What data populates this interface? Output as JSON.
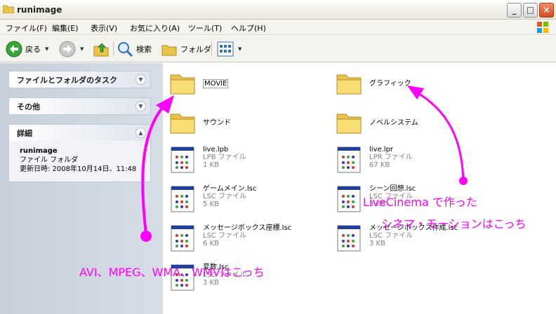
{
  "window": {
    "title": "runimage",
    "btn_min": "_",
    "btn_max": "□",
    "btn_close": "×"
  },
  "menu": [
    {
      "label": "ファイル(F)"
    },
    {
      "label": "編集(E)"
    },
    {
      "label": "表示(V)"
    },
    {
      "label": "お気に入り(A)"
    },
    {
      "label": "ツール(T)"
    },
    {
      "label": "ヘルプ(H)"
    }
  ],
  "toolbar": {
    "back": "戻る",
    "search": "検索",
    "folders": "フォルダ"
  },
  "sidebar": {
    "tasks_title": "ファイルとフォルダのタスク",
    "other_title": "その他",
    "details_title": "詳細",
    "details_name": "runimage",
    "details_type": "ファイル フォルダ",
    "details_date": "更新日時: 2008年10月14日、11:48"
  },
  "items": [
    {
      "name": "MOVIE",
      "kind": "folder"
    },
    {
      "name": "グラフィック",
      "kind": "folder"
    },
    {
      "name": "サウンド",
      "kind": "folder"
    },
    {
      "name": "ノベルシステム",
      "kind": "folder"
    },
    {
      "name": "live.lpb",
      "type": "LPB ファイル",
      "size": "1 KB",
      "kind": "file"
    },
    {
      "name": "live.lpr",
      "type": "LPR ファイル",
      "size": "67 KB",
      "kind": "file"
    },
    {
      "name": "ゲームメイン.lsc",
      "type": "LSC ファイル",
      "size": "5 KB",
      "kind": "file"
    },
    {
      "name": "シーン回想.lsc",
      "type": "LSC ファイル",
      "size": "3 KB",
      "kind": "file"
    },
    {
      "name": "メッセージボックス座標.lsc",
      "type": "LSC ファイル",
      "size": "6 KB",
      "kind": "file"
    },
    {
      "name": "メッセージボックス作成.lsc",
      "type": "LSC ファイル",
      "size": "3 KB",
      "kind": "file"
    },
    {
      "name": "変数.lsc",
      "type": "LSC ファイル",
      "size": "3 KB",
      "kind": "file"
    }
  ],
  "annotations": {
    "bottom": "AVI、MPEG、WMA、WMVはこっち",
    "right_line1": "LiveCinema で作った",
    "right_line2": "シネマ・モーションはこっち",
    "color": "#ff00ff"
  },
  "icons": {
    "window": "folder-icon",
    "back": "back-arrow-icon",
    "forward": "forward-arrow-icon",
    "up": "up-folder-icon",
    "search": "search-icon",
    "folders": "folders-icon",
    "views": "views-icon"
  }
}
